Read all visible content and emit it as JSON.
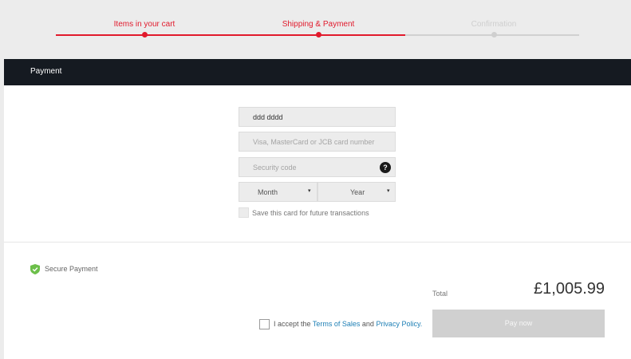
{
  "stepper": {
    "steps": [
      {
        "label": "Items in your cart",
        "state": "done"
      },
      {
        "label": "Shipping & Payment",
        "state": "active"
      },
      {
        "label": "Confirmation",
        "state": "pending"
      }
    ],
    "active_color": "#e11a2c",
    "pending_color": "#d0d0d0"
  },
  "header": {
    "title": "Payment"
  },
  "form": {
    "cardholder_value": "ddd dddd",
    "card_number_placeholder": "Visa, MasterCard or JCB card number",
    "security_code_placeholder": "Security code",
    "help_icon": "question-icon",
    "help_glyph": "?",
    "month_label": "Month",
    "year_label": "Year",
    "caret_glyph": "▾",
    "save_card_label": "Save this card for future transactions"
  },
  "footer": {
    "secure_label": "Secure Payment",
    "secure_icon": "shield-check-icon",
    "secure_color": "#6cbf4a",
    "total_label": "Total",
    "total_amount": "£1,005.99",
    "terms_prefix": "I accept the ",
    "terms_link": "Terms of Sales",
    "terms_and": " and ",
    "privacy_link": "Privacy Policy.",
    "pay_button": "Pay now"
  }
}
